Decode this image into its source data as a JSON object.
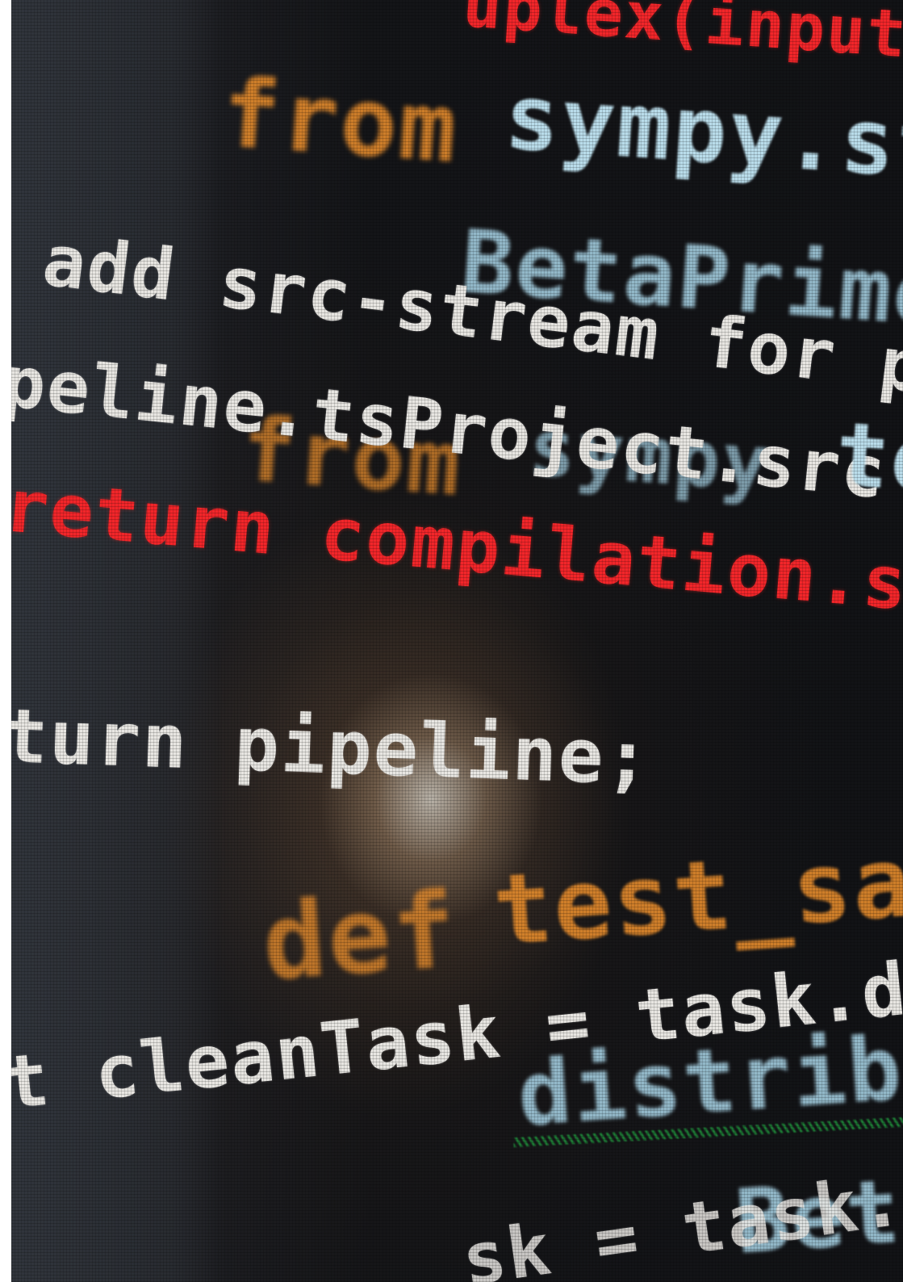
{
  "code_lines": {
    "top_red": "uplex(input",
    "from_1_keyword": "from",
    "from_1_module": "sympy.st",
    "add_line": "add src-stream for pi",
    "beta_prime_1": "BetaPrime",
    "pipeline_line": "peline.tsProject.src",
    "from_2_keyword": "from",
    "from_2_module": "sympy",
    "te_fragment": "te",
    "return_red": "return compilation.sr",
    "return_pipeline": "turn pipeline;",
    "def_keyword": "def",
    "test_name": "test_sam",
    "clean_task": "t cleanTask = task.de",
    "dist_fragment": "distrib",
    "beta_bottom": "Beta",
    "task_bottom": "sk = task."
  },
  "colors": {
    "keyword_orange": "#e38a2c",
    "error_red": "#f2262a",
    "text_white": "#e8e6e2",
    "identifier_blue": "#a9d5e8",
    "underline_green": "#1f8b3a"
  }
}
